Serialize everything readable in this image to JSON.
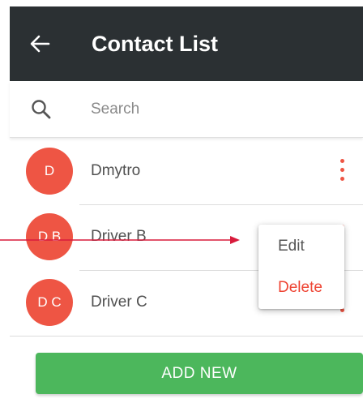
{
  "header": {
    "title": "Contact List",
    "back_icon": "arrow-left-icon",
    "background": "#2b3033"
  },
  "search": {
    "placeholder": "Search",
    "value": "",
    "icon": "search-icon"
  },
  "contacts": [
    {
      "initials": "D",
      "name": "Dmytro"
    },
    {
      "initials": "D B",
      "name": "Driver B"
    },
    {
      "initials": "D C",
      "name": "Driver C"
    }
  ],
  "context_menu": {
    "edit_label": "Edit",
    "delete_label": "Delete"
  },
  "footer": {
    "add_label": "ADD NEW"
  },
  "colors": {
    "avatar": "#ee5544",
    "more_icon": "#ee5544",
    "delete_text": "#ee4433",
    "add_button": "#4cb75c",
    "annotation_arrow": "#d81b3c"
  }
}
